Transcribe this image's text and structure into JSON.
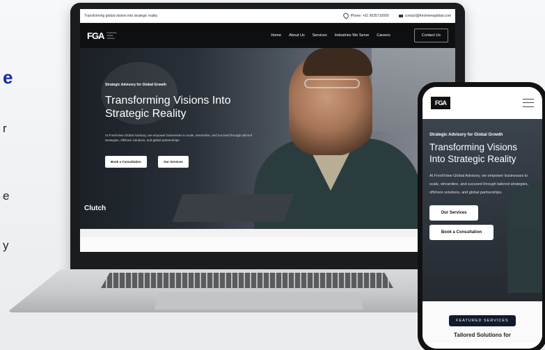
{
  "left_column": {
    "heading_fragment": "e",
    "fragments": [
      "r",
      "e",
      "y"
    ]
  },
  "desktop": {
    "topbar": {
      "tagline": "Transforming global visions into strategic reality.",
      "phone": "Phone: +91 9035710000",
      "email": "contact@freshviewglobal.com"
    },
    "logo": {
      "mark": "FGA",
      "subtitle": "FreshView Global Advisory"
    },
    "nav": [
      "Home",
      "About Us",
      "Services",
      "Industries We Serve",
      "Careers"
    ],
    "contact_button": "Contact Us",
    "hero": {
      "eyebrow": "Strategic Advisory for Global Growth",
      "title": "Transforming Visions Into Strategic Reality",
      "description": "At FreshView Global Advisory, we empower businesses to scale, streamline, and succeed through tailored strategies, offshore solutions, and global partnerships.",
      "primary_button": "Book a Consultation",
      "secondary_button": "Our Services",
      "clutch": "Clutch"
    }
  },
  "mobile": {
    "logo": "FGA",
    "hero": {
      "eyebrow": "Strategic Advisory for Global Growth",
      "title": "Transforming Visions Into Strategic Reality",
      "description": "At FreshView Global Advisory, we empower businesses to scale, streamline, and succeed through tailored strategies, offshore solutions, and global partnerships.",
      "services_button": "Our Services",
      "consult_button": "Book a Consultation"
    },
    "featured_badge": "FEATURED SERVICES",
    "section_title": "Tailored Solutions for"
  },
  "colors": {
    "accent": "#1a2aa8",
    "dark": "#0e0f10"
  }
}
